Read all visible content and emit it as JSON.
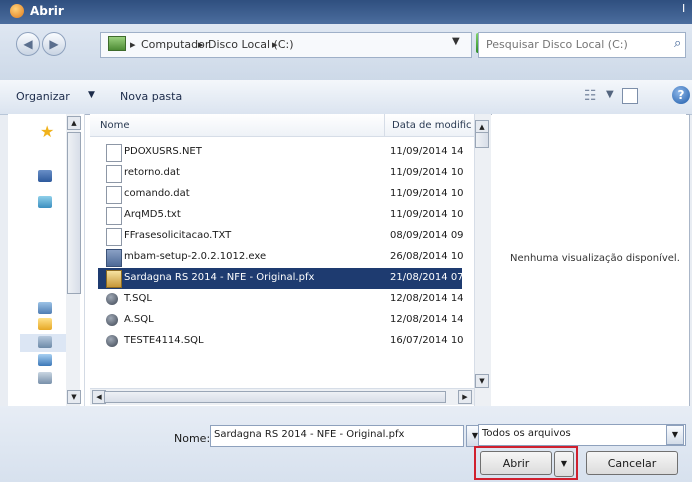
{
  "window": {
    "title": "Abrir",
    "close_glyph": "I"
  },
  "address": {
    "computer_label": "Computador",
    "disk_label": "Disco Local (C:)",
    "separator": "▸"
  },
  "search": {
    "placeholder": "Pesquisar Disco Local (C:)"
  },
  "toolbar": {
    "organizar_label": "Organizar",
    "nova_pasta_label": "Nova pasta"
  },
  "file_list": {
    "columns": {
      "name": "Nome",
      "date": "Data de modific"
    },
    "rows": [
      {
        "name": "PDOXUSRS.NET",
        "date": "11/09/2014 14",
        "icon": "document-icon"
      },
      {
        "name": "retorno.dat",
        "date": "11/09/2014 10",
        "icon": "document-icon"
      },
      {
        "name": "comando.dat",
        "date": "11/09/2014 10",
        "icon": "document-icon"
      },
      {
        "name": "ArqMD5.txt",
        "date": "11/09/2014 10",
        "icon": "document-icon"
      },
      {
        "name": "FFrasesolicitacao.TXT",
        "date": "08/09/2014 09",
        "icon": "document-icon"
      },
      {
        "name": "mbam-setup-2.0.2.1012.exe",
        "date": "26/08/2014 10",
        "icon": "installer-icon"
      },
      {
        "name": "Sardagna RS 2014 - NFE - Original.pfx",
        "date": "21/08/2014 07",
        "icon": "certificate-icon",
        "selected": true
      },
      {
        "name": "T.SQL",
        "date": "12/08/2014 14",
        "icon": "sql-icon"
      },
      {
        "name": "A.SQL",
        "date": "12/08/2014 14",
        "icon": "sql-icon"
      },
      {
        "name": "TESTE4114.SQL",
        "date": "16/07/2014 10",
        "icon": "sql-icon"
      }
    ]
  },
  "preview": {
    "message": "Nenhuma visualização disponível."
  },
  "bottom": {
    "name_label": "Nome:",
    "name_value": "Sardagna RS 2014 - NFE - Original.pfx",
    "filter_value": "Todos os arquivos",
    "open_label": "Abrir",
    "cancel_label": "Cancelar"
  },
  "colors": {
    "selection": "#1e3b70",
    "highlight_border": "#d0202e",
    "titlebar": "#2f4f7f"
  }
}
